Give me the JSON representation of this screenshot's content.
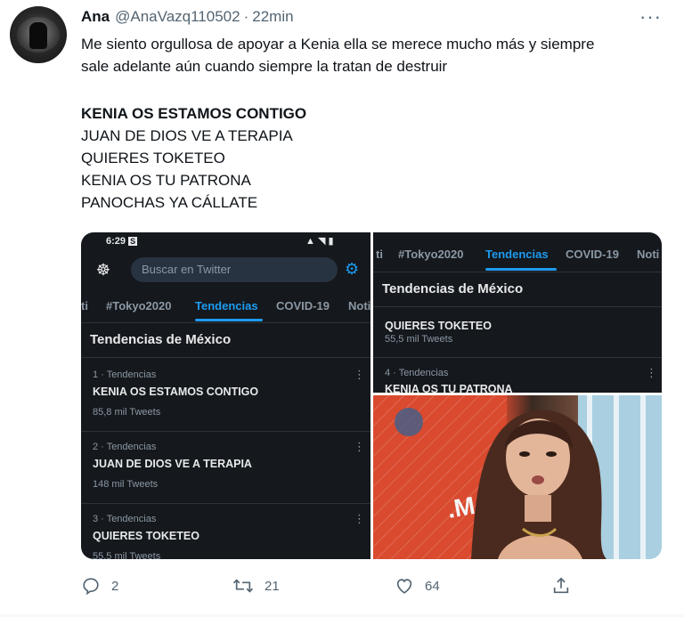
{
  "tweet": {
    "author_name": "Ana",
    "author_handle": "@AnaVazq110502",
    "separator": "·",
    "time": "22min",
    "more": "···",
    "text_line1": "Me siento orgullosa de apoyar a Kenia ella se merece mucho más y siempre",
    "text_line2": "sale adelante aún cuando siempre la tratan de destruir",
    "list": [
      "KENIA OS ESTAMOS CONTIGO",
      "JUAN DE DIOS VE A TERAPIA",
      "QUIERES TOKETEO",
      "KENIA OS TU PATRONA",
      "PANOCHAS YA CÁLLATE"
    ]
  },
  "screenshot_left": {
    "status_time": "6:29",
    "status_badge": "S",
    "search_placeholder": "Buscar en Twitter",
    "tabs": [
      "ti",
      "#Tokyo2020",
      "Tendencias",
      "COVID-19",
      "Noti"
    ],
    "section_title": "Tendencias de México",
    "trends": [
      {
        "meta": "1 · Tendencias",
        "title": "KENIA OS ESTAMOS CONTIGO",
        "count": "85,8 mil Tweets"
      },
      {
        "meta": "2 · Tendencias",
        "title": "JUAN DE DIOS VE A TERAPIA",
        "count": "148 mil Tweets"
      },
      {
        "meta": "3 · Tendencias",
        "title": "QUIERES TOKETEO",
        "count": "55,5 mil Tweets"
      }
    ]
  },
  "screenshot_right": {
    "tabs": [
      "ti",
      "#Tokyo2020",
      "Tendencias",
      "COVID-19",
      "Noti"
    ],
    "section_title": "Tendencias de México",
    "trends": [
      {
        "meta": "",
        "title": "QUIERES TOKETEO",
        "count": "55,5 mil Tweets"
      },
      {
        "meta": "4 · Tendencias",
        "title": "KENIA OS TU PATRONA",
        "count": ""
      }
    ]
  },
  "actions": {
    "replies": "2",
    "retweets": "21",
    "likes": "64"
  },
  "colors": {
    "accent": "#1d9bf0",
    "muted": "#536471",
    "dark_bg": "#15181c"
  }
}
